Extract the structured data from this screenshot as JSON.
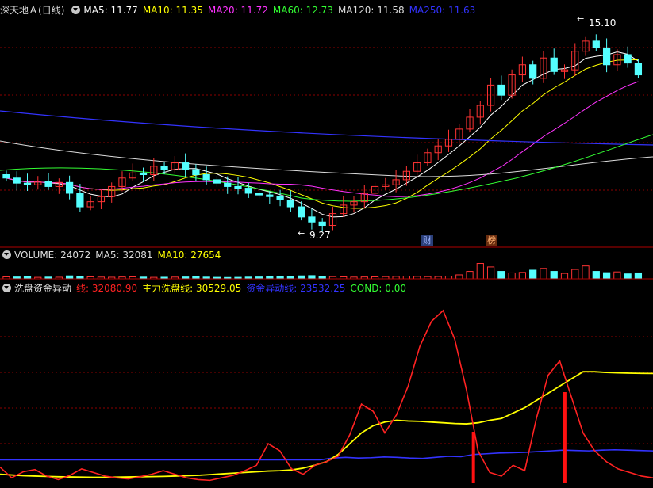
{
  "main": {
    "stock_name": "深天地Ａ",
    "period": "(日线)",
    "indicators": [
      {
        "label": "MA5: 11.77",
        "color": "#ffffff"
      },
      {
        "label": "MA10: 11.35",
        "color": "#ffff00"
      },
      {
        "label": "MA20: 11.72",
        "color": "#ff33ff"
      },
      {
        "label": "MA60: 12.73",
        "color": "#33ff33"
      },
      {
        "label": "MA120: 11.58",
        "color": "#dddddd"
      },
      {
        "label": "MA250: 11.63",
        "color": "#3333ff"
      }
    ],
    "high_label": "15.10",
    "low_label": "9.27",
    "badge_cai": "财",
    "badge_bang": "榜"
  },
  "volume": {
    "indicators": [
      {
        "label": "VOLUME: 24072",
        "color": "#dddddd"
      },
      {
        "label": "MA5: 32081",
        "color": "#dddddd"
      },
      {
        "label": "MA10: 27654",
        "color": "#ffff00"
      }
    ]
  },
  "indicator": {
    "title": "洗盘资金异动",
    "indicators": [
      {
        "label": "线: 32080.90",
        "color": "#ff2222"
      },
      {
        "label": "主力洗盘线: 30529.05",
        "color": "#ffff00"
      },
      {
        "label": "资金异动线: 23532.25",
        "color": "#3333ff"
      },
      {
        "label": "COND: 0.00",
        "color": "#33ff33"
      }
    ]
  },
  "colors": {
    "up": "#ff3333",
    "down": "#54ffff",
    "grid": "#8b0000",
    "separator": "#b00000"
  },
  "chart_data": {
    "type": "candlestick",
    "price_range": [
      8.8,
      15.5
    ],
    "high": 15.1,
    "low": 9.27,
    "closes": [
      10.75,
      10.6,
      10.55,
      10.65,
      10.5,
      10.62,
      10.3,
      9.9,
      10.05,
      10.2,
      10.5,
      10.75,
      10.9,
      10.85,
      11.1,
      11.0,
      11.2,
      11.0,
      10.85,
      10.7,
      10.6,
      10.5,
      10.45,
      10.3,
      10.25,
      10.2,
      10.1,
      9.9,
      9.6,
      9.45,
      9.35,
      9.7,
      9.95,
      10.05,
      10.3,
      10.5,
      10.55,
      10.7,
      10.95,
      11.2,
      11.5,
      11.7,
      11.9,
      12.2,
      12.55,
      12.9,
      13.5,
      13.2,
      13.8,
      14.1,
      13.7,
      14.3,
      13.9,
      13.95,
      14.5,
      14.8,
      14.6,
      14.1,
      14.4,
      14.15,
      13.8
    ],
    "volume_max": 70000,
    "vol": [
      8000,
      7500,
      9000,
      6000,
      7000,
      6500,
      12000,
      9000,
      8000,
      7000,
      6500,
      7500,
      8000,
      7000,
      6000,
      6500,
      7000,
      7500,
      8000,
      7000,
      6000,
      5500,
      6000,
      7000,
      7500,
      9000,
      8000,
      9000,
      12000,
      13000,
      11000,
      9000,
      8000,
      7000,
      7500,
      8000,
      9000,
      10000,
      11000,
      10000,
      9000,
      9500,
      11000,
      16000,
      30000,
      62000,
      48000,
      30000,
      24000,
      26000,
      35000,
      42000,
      30000,
      22000,
      38000,
      52000,
      30000,
      25000,
      28000,
      20000,
      24000
    ],
    "ind_range": [
      0,
      48000
    ],
    "red_line": [
      4500,
      1500,
      3200,
      3800,
      2000,
      1000,
      2200,
      4000,
      3000,
      2000,
      1500,
      1200,
      1800,
      2500,
      3500,
      2500,
      1500,
      1000,
      800,
      1500,
      2200,
      3500,
      5000,
      11000,
      9000,
      4000,
      2500,
      5000,
      6000,
      7500,
      13500,
      22000,
      20000,
      14000,
      19000,
      27000,
      38000,
      45000,
      48000,
      40000,
      26000,
      9000,
      3000,
      2000,
      5000,
      3500,
      18000,
      30000,
      34000,
      24000,
      14000,
      9000,
      6000,
      4000,
      3000,
      2000,
      1500
    ],
    "yellow_line": [
      2500,
      2300,
      2100,
      2000,
      1900,
      1800,
      1750,
      1700,
      1650,
      1650,
      1700,
      1750,
      1800,
      1850,
      1900,
      2000,
      2100,
      2200,
      2400,
      2600,
      2800,
      3000,
      3200,
      3400,
      3500,
      3700,
      4200,
      5000,
      6000,
      8000,
      11000,
      14000,
      16000,
      17000,
      17500,
      17300,
      17200,
      17000,
      16800,
      16600,
      16500,
      16800,
      17500,
      18000,
      19500,
      21000,
      23000,
      25000,
      27000,
      29000,
      31000,
      31000,
      30800,
      30700,
      30600,
      30550,
      30529
    ],
    "blue_line": [
      6500,
      6500,
      6500,
      6500,
      6500,
      6500,
      6500,
      6500,
      6500,
      6500,
      6500,
      6500,
      6500,
      6500,
      6500,
      6500,
      6500,
      6500,
      6500,
      6500,
      6500,
      6500,
      6500,
      6500,
      6500,
      6500,
      7000,
      7200,
      7000,
      7100,
      7300,
      7200,
      7000,
      6900,
      7200,
      7500,
      7400,
      8000,
      8200,
      8400,
      8500,
      8600,
      8800,
      9000,
      9200,
      9100,
      9000,
      9200,
      9300,
      9200,
      9100,
      9000
    ],
    "signals": [
      0.725,
      0.865
    ]
  }
}
